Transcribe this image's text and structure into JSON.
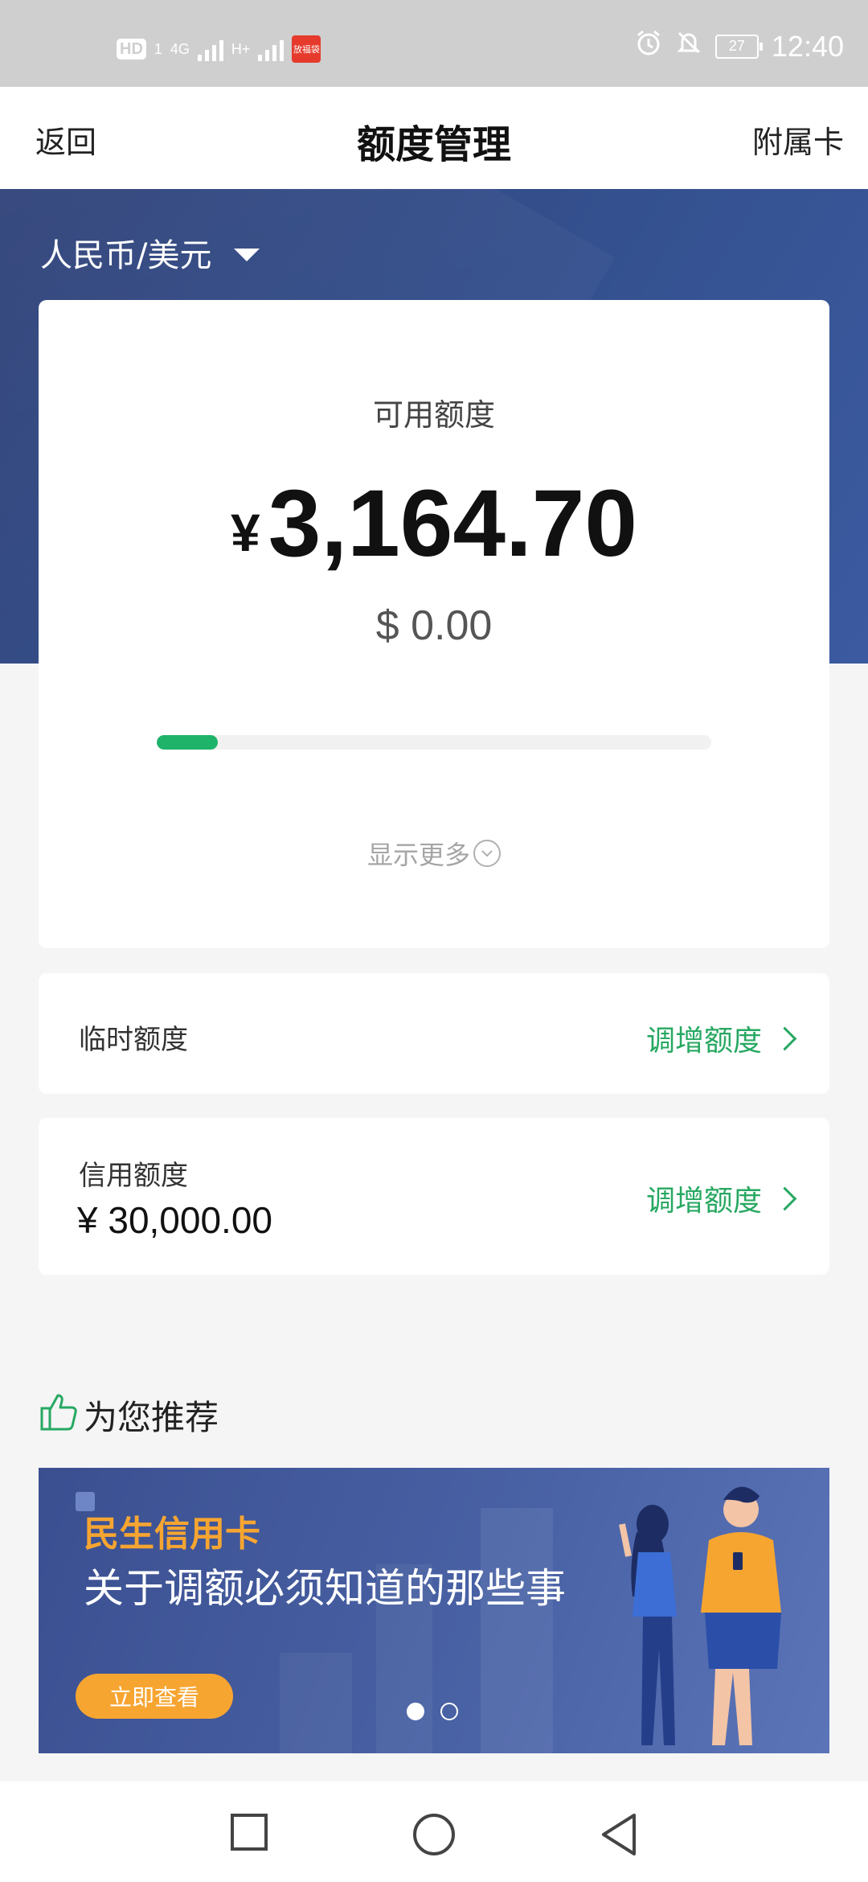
{
  "status_bar": {
    "hd": "HD",
    "sim_badge": "1",
    "net1": "4G",
    "net2": "H+",
    "app_badge": "放福袋",
    "battery": "27",
    "time": "12:40"
  },
  "nav": {
    "back": "返回",
    "title": "额度管理",
    "right": "附属卡"
  },
  "currency_selector": "人民币/美元",
  "available": {
    "label": "可用额度",
    "yen_symbol": "¥",
    "amount": "3,164.70",
    "usd": "$ 0.00",
    "progress_fraction": 0.11,
    "show_more": "显示更多"
  },
  "temp_limit": {
    "label": "临时额度",
    "action": "调增额度"
  },
  "credit_limit": {
    "label": "信用额度",
    "value": "¥ 30,000.00",
    "action": "调增额度"
  },
  "recommend": {
    "title": "为您推荐",
    "banner_brand": "民生信用卡",
    "banner_headline": "关于调额必须知道的那些事",
    "banner_cta": "立即查看"
  },
  "colors": {
    "accent_green": "#27a862",
    "progress_green": "#1fb36a",
    "hero_blue": "#34508e",
    "banner_orange": "#f7a531"
  }
}
